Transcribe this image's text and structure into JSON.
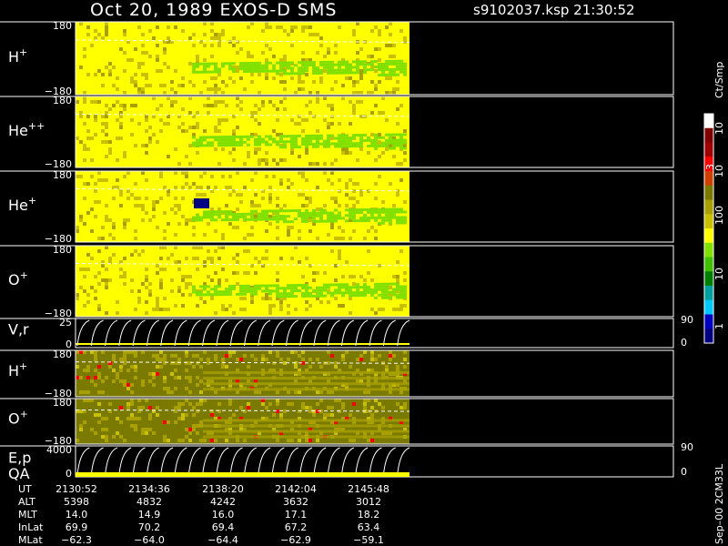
{
  "header": {
    "title": "Oct 20, 1989   EXOS-D SMS",
    "file": "s9102037.ksp  21:30:52"
  },
  "chart_data": {
    "type": "heatmap",
    "panels": [
      {
        "label": "H",
        "sup": "+",
        "ymax_label": "180",
        "ymin_label": "−180",
        "kind": "angle-yellow"
      },
      {
        "label": "He",
        "sup": "++",
        "ymax_label": "180",
        "ymin_label": "−180",
        "kind": "angle-yellow"
      },
      {
        "label": "He",
        "sup": "+",
        "ymax_label": "180",
        "ymin_label": "−180",
        "kind": "angle-yellow"
      },
      {
        "label": "O",
        "sup": "+",
        "ymax_label": "180",
        "ymin_label": "−180",
        "kind": "angle-yellow"
      },
      {
        "label": "V,r",
        "sup": "",
        "ymax_label": "25",
        "ymin_label": "0",
        "right_top": "90",
        "right_bottom": "0",
        "kind": "curves"
      },
      {
        "label": "H",
        "sup": "+",
        "ymax_label": "180",
        "ymin_label": "−180",
        "kind": "angle-olive"
      },
      {
        "label": "O",
        "sup": "+",
        "ymax_label": "180",
        "ymin_label": "−180",
        "kind": "angle-olive"
      },
      {
        "label": "E,p",
        "label2": "QA",
        "sup": "",
        "ymax_label": "4000",
        "ymin_label": "0",
        "right_top": "90",
        "right_bottom": "0",
        "kind": "curves"
      }
    ],
    "colorbar": {
      "unit_label": "Ct/Smp",
      "ticks": [
        "10",
        "4",
        "10",
        "3",
        "100",
        "10",
        "1"
      ],
      "colors": [
        "#ffffff",
        "#800000",
        "#a00000",
        "#ff0000",
        "#d04000",
        "#7a7a00",
        "#a8a000",
        "#c8c000",
        "#ffff00",
        "#80e000",
        "#40c000",
        "#008000",
        "#00a0a0",
        "#00c8ff",
        "#0000c0",
        "#000080"
      ]
    },
    "footer_label": "Sep–00 2CM33L",
    "ephemeris": {
      "rows": [
        {
          "name": "UT",
          "values": [
            "2130:52",
            "2134:36",
            "2138:20",
            "2142:04",
            "2145:48"
          ]
        },
        {
          "name": "ALT",
          "values": [
            "5398",
            "4832",
            "4242",
            "3632",
            "3012"
          ]
        },
        {
          "name": "MLT",
          "values": [
            "14.0",
            "14.9",
            "16.0",
            "17.1",
            "18.2"
          ]
        },
        {
          "name": "InLat",
          "values": [
            "69.9",
            "70.2",
            "69.4",
            "67.2",
            "63.4"
          ]
        },
        {
          "name": "MLat",
          "values": [
            "−62.3",
            "−64.0",
            "−64.4",
            "−62.9",
            "−59.1"
          ]
        }
      ]
    }
  }
}
